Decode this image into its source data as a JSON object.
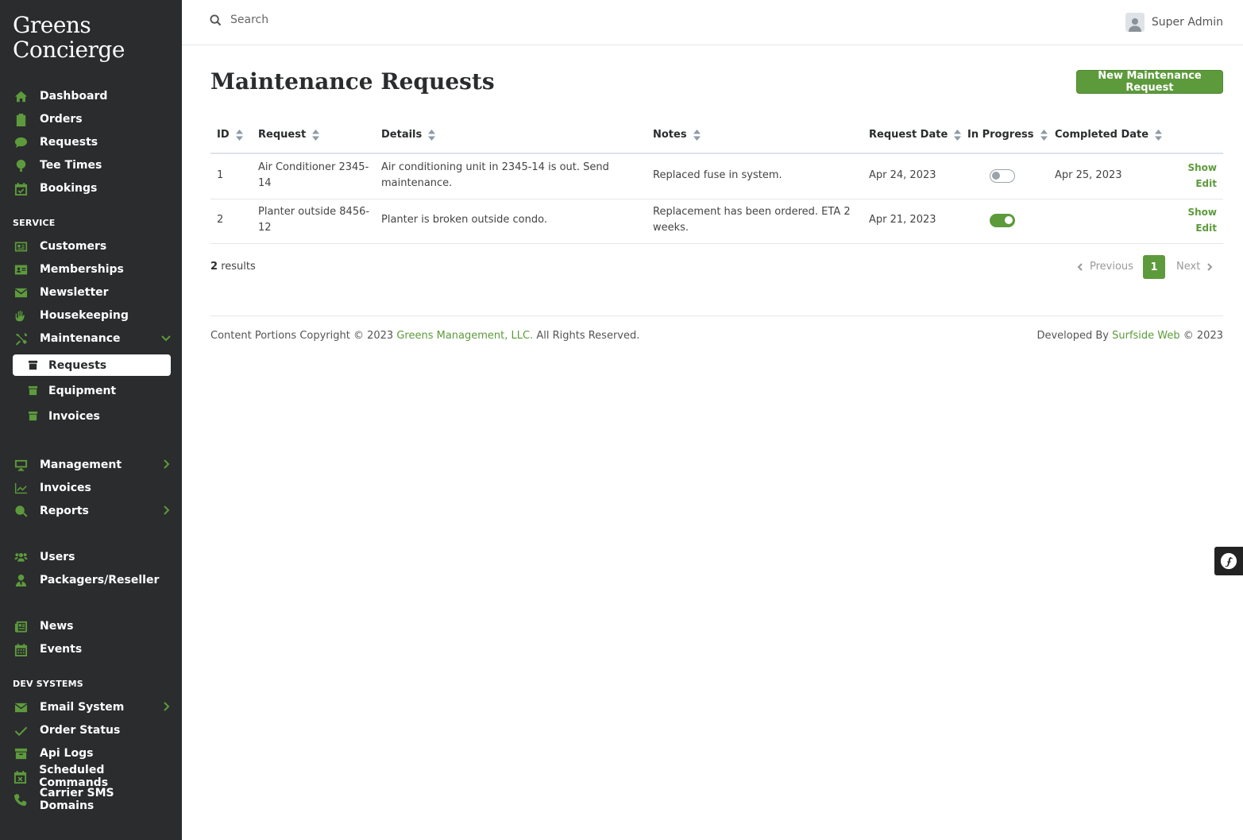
{
  "sidebar": {
    "brand_line1": "Greens",
    "brand_line2": "Concierge",
    "items_top": [
      {
        "label": "Dashboard",
        "icon": "home-icon"
      },
      {
        "label": "Orders",
        "icon": "clipboard-icon"
      },
      {
        "label": "Requests",
        "icon": "comment-dollar-icon"
      },
      {
        "label": "Tee Times",
        "icon": "golf-icon"
      },
      {
        "label": "Bookings",
        "icon": "calendar-check-icon"
      }
    ],
    "section_service": "SERVICE",
    "items_service": [
      {
        "label": "Customers",
        "icon": "id-card-icon"
      },
      {
        "label": "Memberships",
        "icon": "address-card-icon"
      },
      {
        "label": "Newsletter",
        "icon": "envelope-icon"
      },
      {
        "label": "Housekeeping",
        "icon": "hands-icon"
      },
      {
        "label": "Maintenance",
        "icon": "tools-icon"
      }
    ],
    "maintenance_sub": [
      {
        "label": "Requests",
        "icon": "box-icon"
      },
      {
        "label": "Equipment",
        "icon": "box-icon"
      },
      {
        "label": "Invoices",
        "icon": "box-icon"
      }
    ],
    "items_management": [
      {
        "label": "Management",
        "icon": "desktop-icon"
      },
      {
        "label": "Invoices",
        "icon": "chart-line-icon"
      },
      {
        "label": "Reports",
        "icon": "search-dollar-icon"
      }
    ],
    "items_users": [
      {
        "label": "Users",
        "icon": "users-icon"
      },
      {
        "label": "Packagers/Reseller",
        "icon": "user-tie-icon"
      }
    ],
    "items_news": [
      {
        "label": "News",
        "icon": "newspaper-icon"
      },
      {
        "label": "Events",
        "icon": "calendar-icon"
      }
    ],
    "section_dev": "DEV SYSTEMS",
    "items_dev": [
      {
        "label": "Email System",
        "icon": "envelope-icon"
      },
      {
        "label": "Order Status",
        "icon": "check-icon"
      },
      {
        "label": "Api Logs",
        "icon": "archive-icon"
      },
      {
        "label": "Scheduled Commands",
        "icon": "calendar-times-icon"
      },
      {
        "label": "Carrier SMS Domains",
        "icon": "phone-icon"
      }
    ]
  },
  "topbar": {
    "search_placeholder": "Search",
    "user_name": "Super Admin"
  },
  "main": {
    "title": "Maintenance Requests",
    "new_button": "New Maintenance Request",
    "columns": [
      "ID",
      "Request",
      "Details",
      "Notes",
      "Request Date",
      "In Progress",
      "Completed Date"
    ],
    "rows": [
      {
        "id": "1",
        "request_l1": "Air Conditioner 2345-",
        "request_l2": "14",
        "details_l1": "Air conditioning unit in 2345-14 is out. Send",
        "details_l2": "maintenance.",
        "notes_l1": "Replaced fuse in system.",
        "notes_l2": "",
        "request_date": "Apr 24, 2023",
        "in_progress": false,
        "completed_date": "Apr 25, 2023",
        "show": "Show",
        "edit": "Edit"
      },
      {
        "id": "2",
        "request_l1": "Planter outside 8456-",
        "request_l2": "12",
        "details_l1": "Planter is broken outside condo.",
        "details_l2": "",
        "notes_l1": "Replacement has been ordered. ETA 2",
        "notes_l2": "weeks.",
        "request_date": "Apr 21, 2023",
        "in_progress": true,
        "completed_date": "",
        "show": "Show",
        "edit": "Edit"
      }
    ],
    "results_count": "2",
    "results_label": "results",
    "pager": {
      "previous": "Previous",
      "current": "1",
      "next": "Next"
    }
  },
  "footer": {
    "left_prefix": "Content Portions Copyright © 2023",
    "left_link": "Greens Management, LLC.",
    "left_suffix": "All Rights Reserved.",
    "right_prefix": "Developed By",
    "right_link": "Surfside Web",
    "right_suffix": "© 2023"
  },
  "colors": {
    "accent": "#5d9a3c",
    "sidebar_bg": "#2a2c2d"
  }
}
